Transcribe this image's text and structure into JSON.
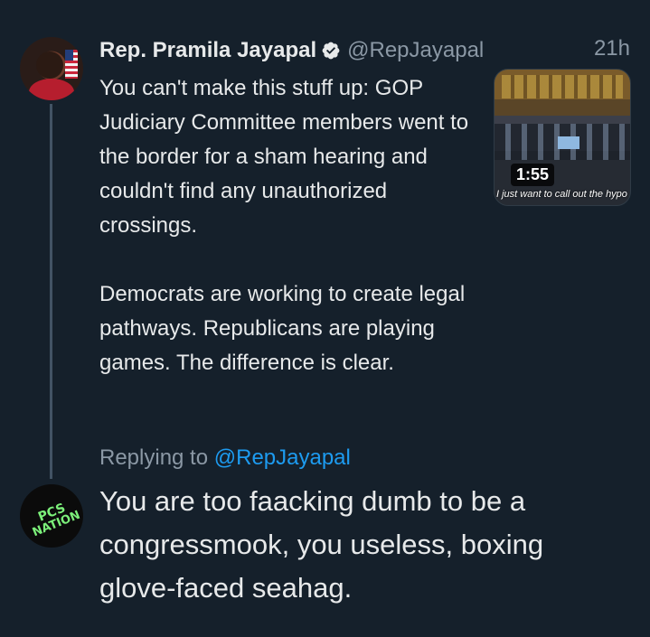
{
  "tweet": {
    "author_name": "Rep. Pramila Jayapal",
    "author_handle": "@RepJayapal",
    "timestamp": "21h",
    "text_paragraphs": [
      "You can't make this stuff up: GOP Judiciary Committee members went to the border for a sham hearing and couldn't find any unauthorized crossings.",
      "Democrats are working to create legal pathways. Republicans are playing games. The difference is clear."
    ],
    "media": {
      "duration": "1:55",
      "caption": "I just want to call out the hypo"
    }
  },
  "reply": {
    "replying_to_label": "Replying to",
    "replying_to_handle": "@RepJayapal",
    "text": "You are too faacking dumb to be a congressmook, you useless, boxing glove-faced seahag.",
    "avatar_text": [
      "PCS",
      "NATION"
    ]
  },
  "colors": {
    "background": "#15202b",
    "text_primary": "#e7e9ea",
    "text_secondary": "#8b98a5",
    "link": "#1d9bf0",
    "verified_badge": "#e7e9ea",
    "logo_green": "#7cf07a"
  }
}
